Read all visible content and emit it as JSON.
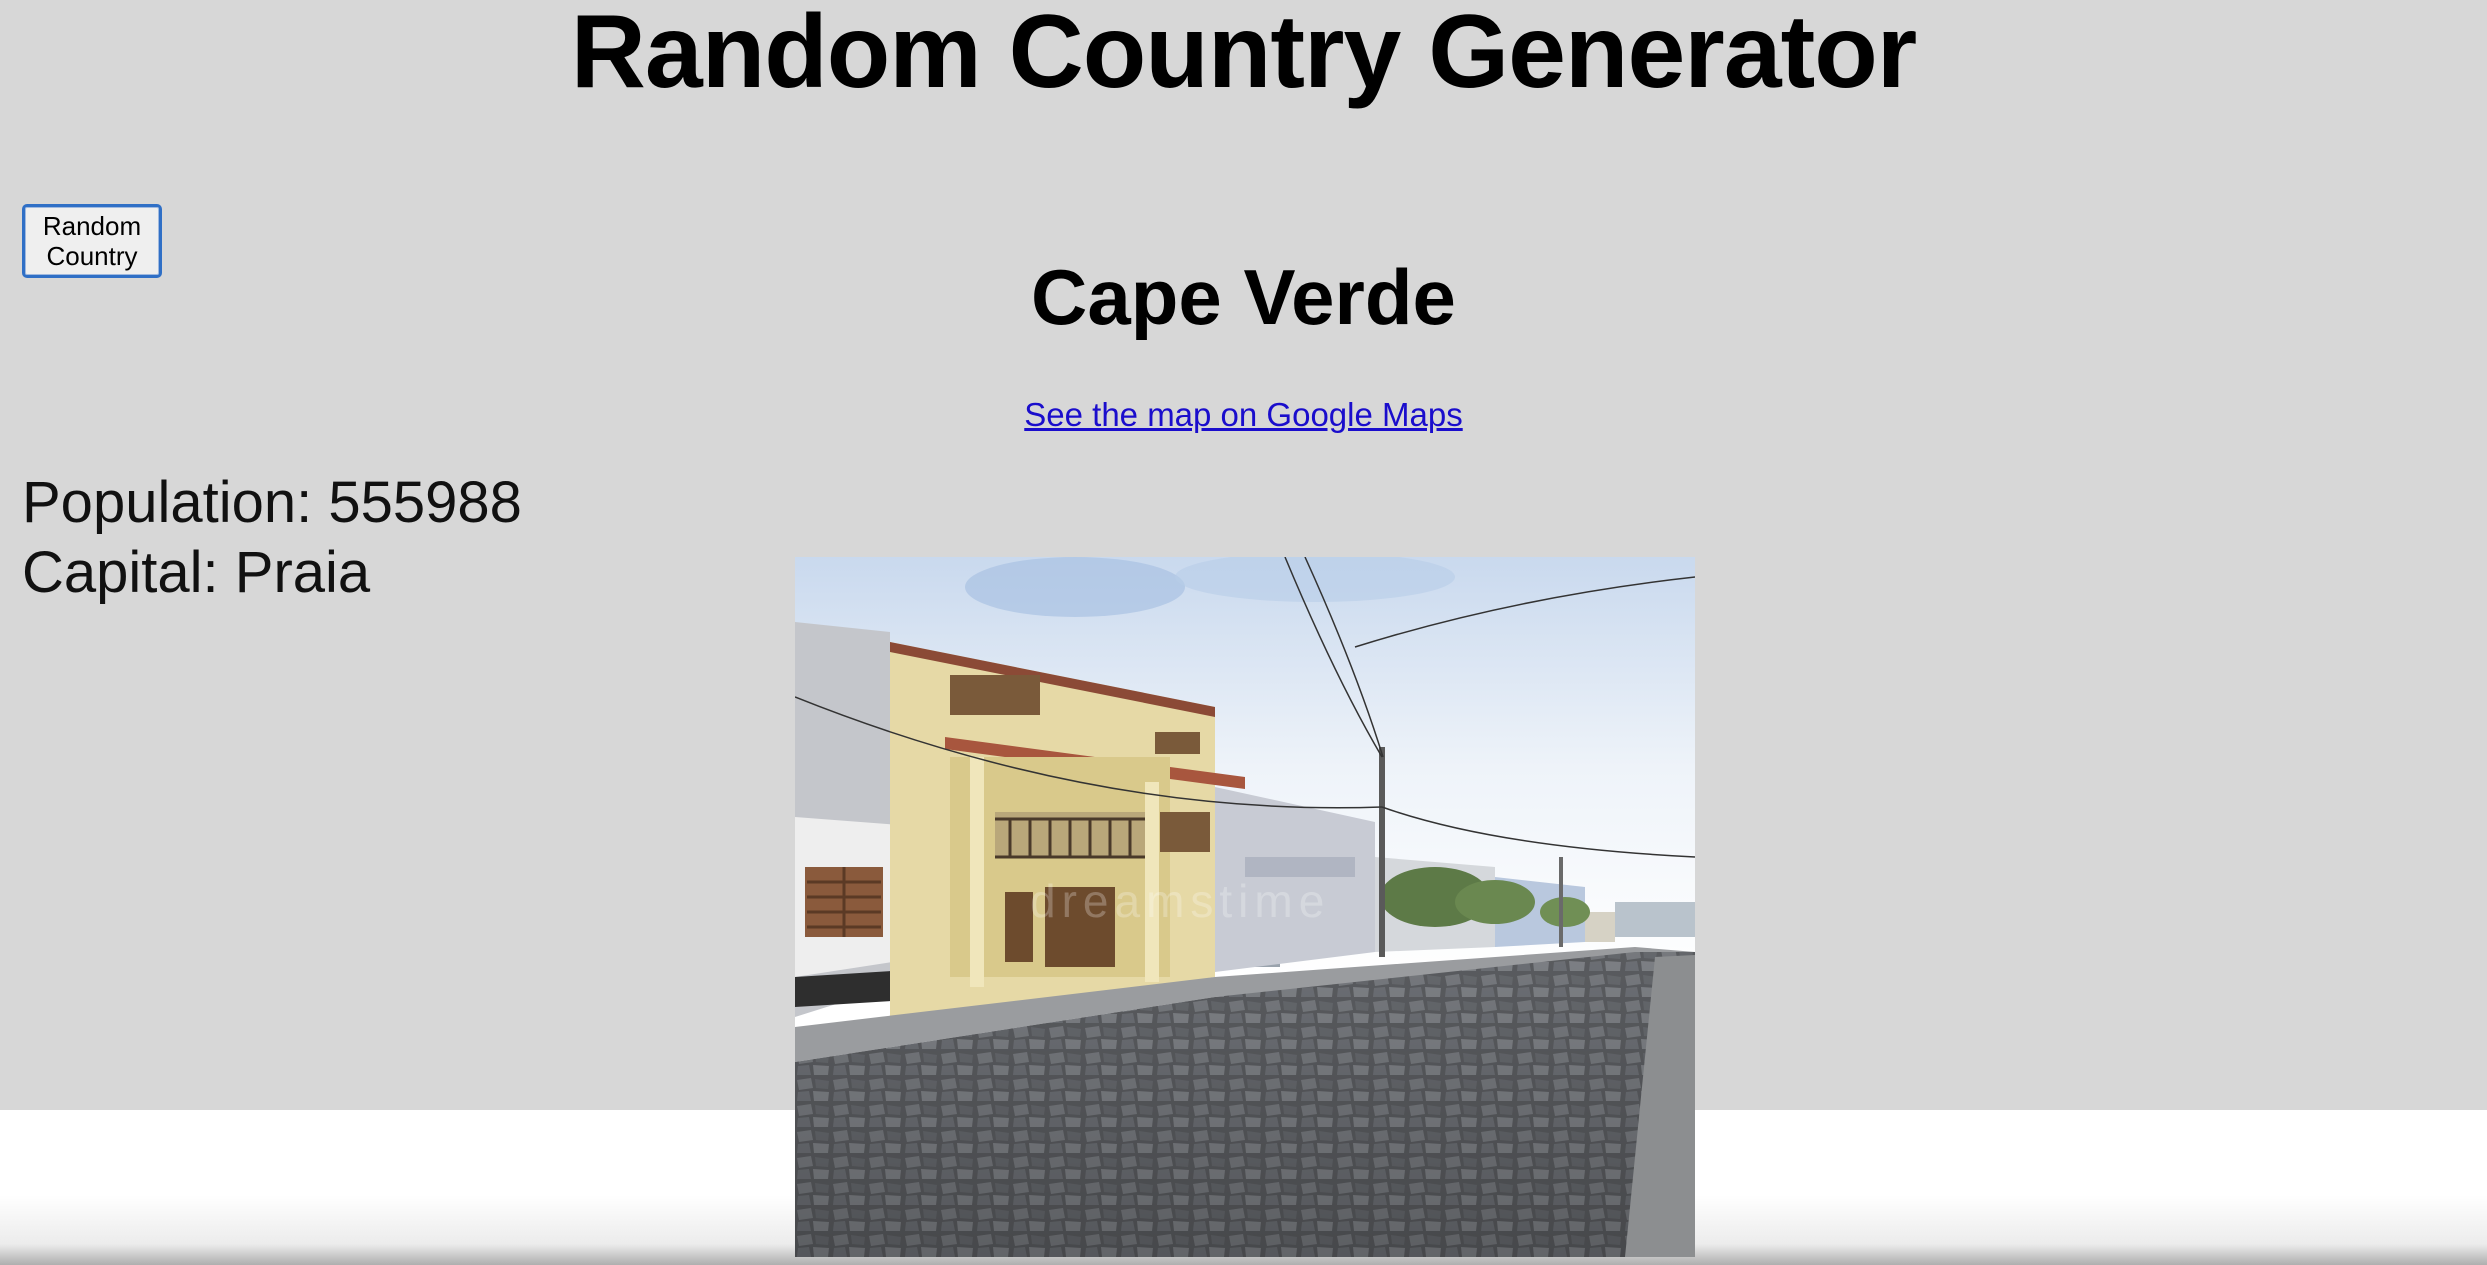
{
  "page": {
    "title": "Random Country Generator",
    "random_button_label": "Random Country"
  },
  "country": {
    "name": "Cape Verde",
    "map_link_text": "See the map on Google Maps",
    "population_label": "Population:",
    "population": "555988",
    "capital_label": "Capital:",
    "capital": "Praia",
    "photo_alt": "Street view in Cape Verde"
  },
  "colors": {
    "background": "#d7d7d7",
    "link": "#1a0dcc",
    "button_border": "#2f6fc6"
  }
}
